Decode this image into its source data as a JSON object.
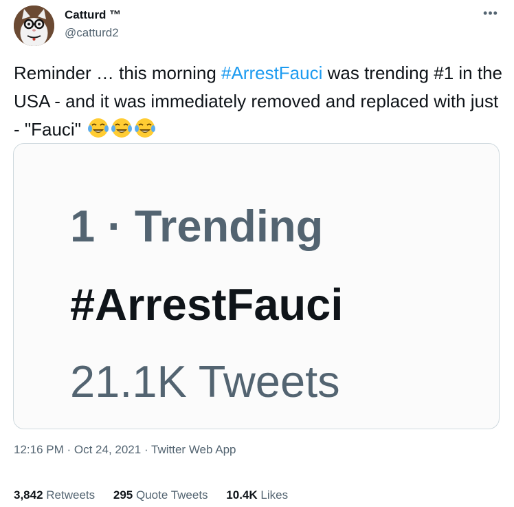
{
  "user": {
    "display_name": "Catturd ™",
    "handle": "@catturd2"
  },
  "menu_glyph": "•••",
  "tweet": {
    "text_parts": [
      "Reminder … this morning ",
      "#ArrestFauci",
      " was trending #1 in the USA - and it was immediately removed and replaced with just - \"Fauci\" "
    ],
    "emojis": [
      "face-with-tears-of-joy",
      "face-with-tears-of-joy",
      "face-with-tears-of-joy"
    ]
  },
  "media": {
    "line1": "1 · Trending",
    "line2": "#ArrestFauci",
    "line3": "21.1K Tweets"
  },
  "meta": {
    "time": "12:16 PM",
    "sep1": " · ",
    "date": "Oct 24, 2021",
    "sep2": " · ",
    "source": "Twitter Web App"
  },
  "stats": {
    "retweets_count": "3,842",
    "retweets_label": " Retweets",
    "quotes_count": "295",
    "quotes_label": " Quote Tweets",
    "likes_count": "10.4K",
    "likes_label": " Likes"
  },
  "colors": {
    "link": "#1d9bf0",
    "text": "#0f1419",
    "secondary": "#536471",
    "border": "#cfd9de"
  }
}
